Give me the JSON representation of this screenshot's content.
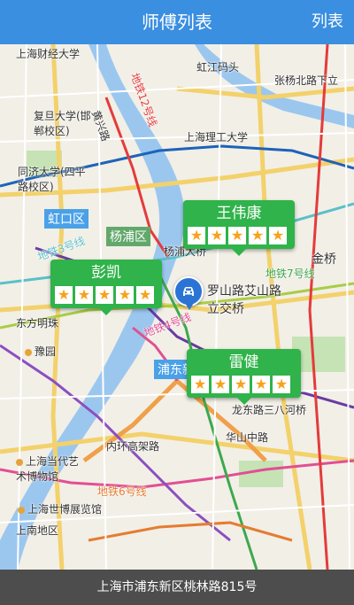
{
  "header": {
    "title": "师傅列表",
    "action": "列表"
  },
  "map_labels": [
    "上海财经大学",
    "虹江码头",
    "张杨北路下立",
    "复旦大学(邯郸校区)",
    "上海理工大学",
    "同济大学(四平路校区)",
    "虹口区",
    "杨浦区",
    "杨浦大桥",
    "金桥",
    "罗山路艾山路立交桥",
    "东方明珠",
    "豫园",
    "浦东新区",
    "龙东路三八河桥",
    "内环高架路",
    "上海当代艺术博物馆",
    "上海世博展览馆",
    "上南地区",
    "地铁12号线",
    "地铁3号线",
    "地铁4号线",
    "地铁6号线",
    "地铁7号线",
    "黄兴路",
    "华山中路"
  ],
  "masters": [
    {
      "name": "王伟康",
      "rating": 5
    },
    {
      "name": "彭凯",
      "rating": 5
    },
    {
      "name": "雷健",
      "rating": 5
    }
  ],
  "address": "上海市浦东新区桃林路815号",
  "colors": {
    "topbar": "#3a8fe0",
    "card": "#2fb34a",
    "star": "#f7a21b",
    "bottombar": "#4d4d4d"
  }
}
